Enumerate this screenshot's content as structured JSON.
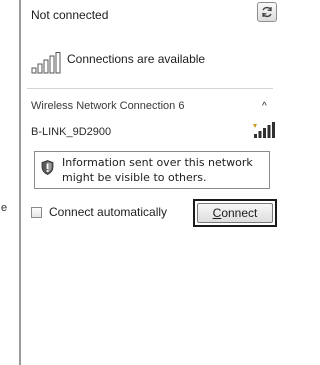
{
  "status": {
    "title": "Not connected",
    "refresh_icon": "refresh-icon"
  },
  "connections": {
    "label": "Connections are available",
    "icon": "signal-bars-icon"
  },
  "wireless": {
    "header": "Wireless Network Connection 6",
    "chevron": "^",
    "network_name": "B-LINK_9D2900",
    "signal_icon": "signal-strength-icon",
    "warning_line1": "Information sent over this network",
    "warning_line2": "might be visible to others.",
    "warning_icon": "shield-icon"
  },
  "actions": {
    "auto_label": "Connect automatically",
    "auto_checked": false,
    "connect_mnemonic": "C",
    "connect_rest": "onnect"
  },
  "stray_text": "e"
}
